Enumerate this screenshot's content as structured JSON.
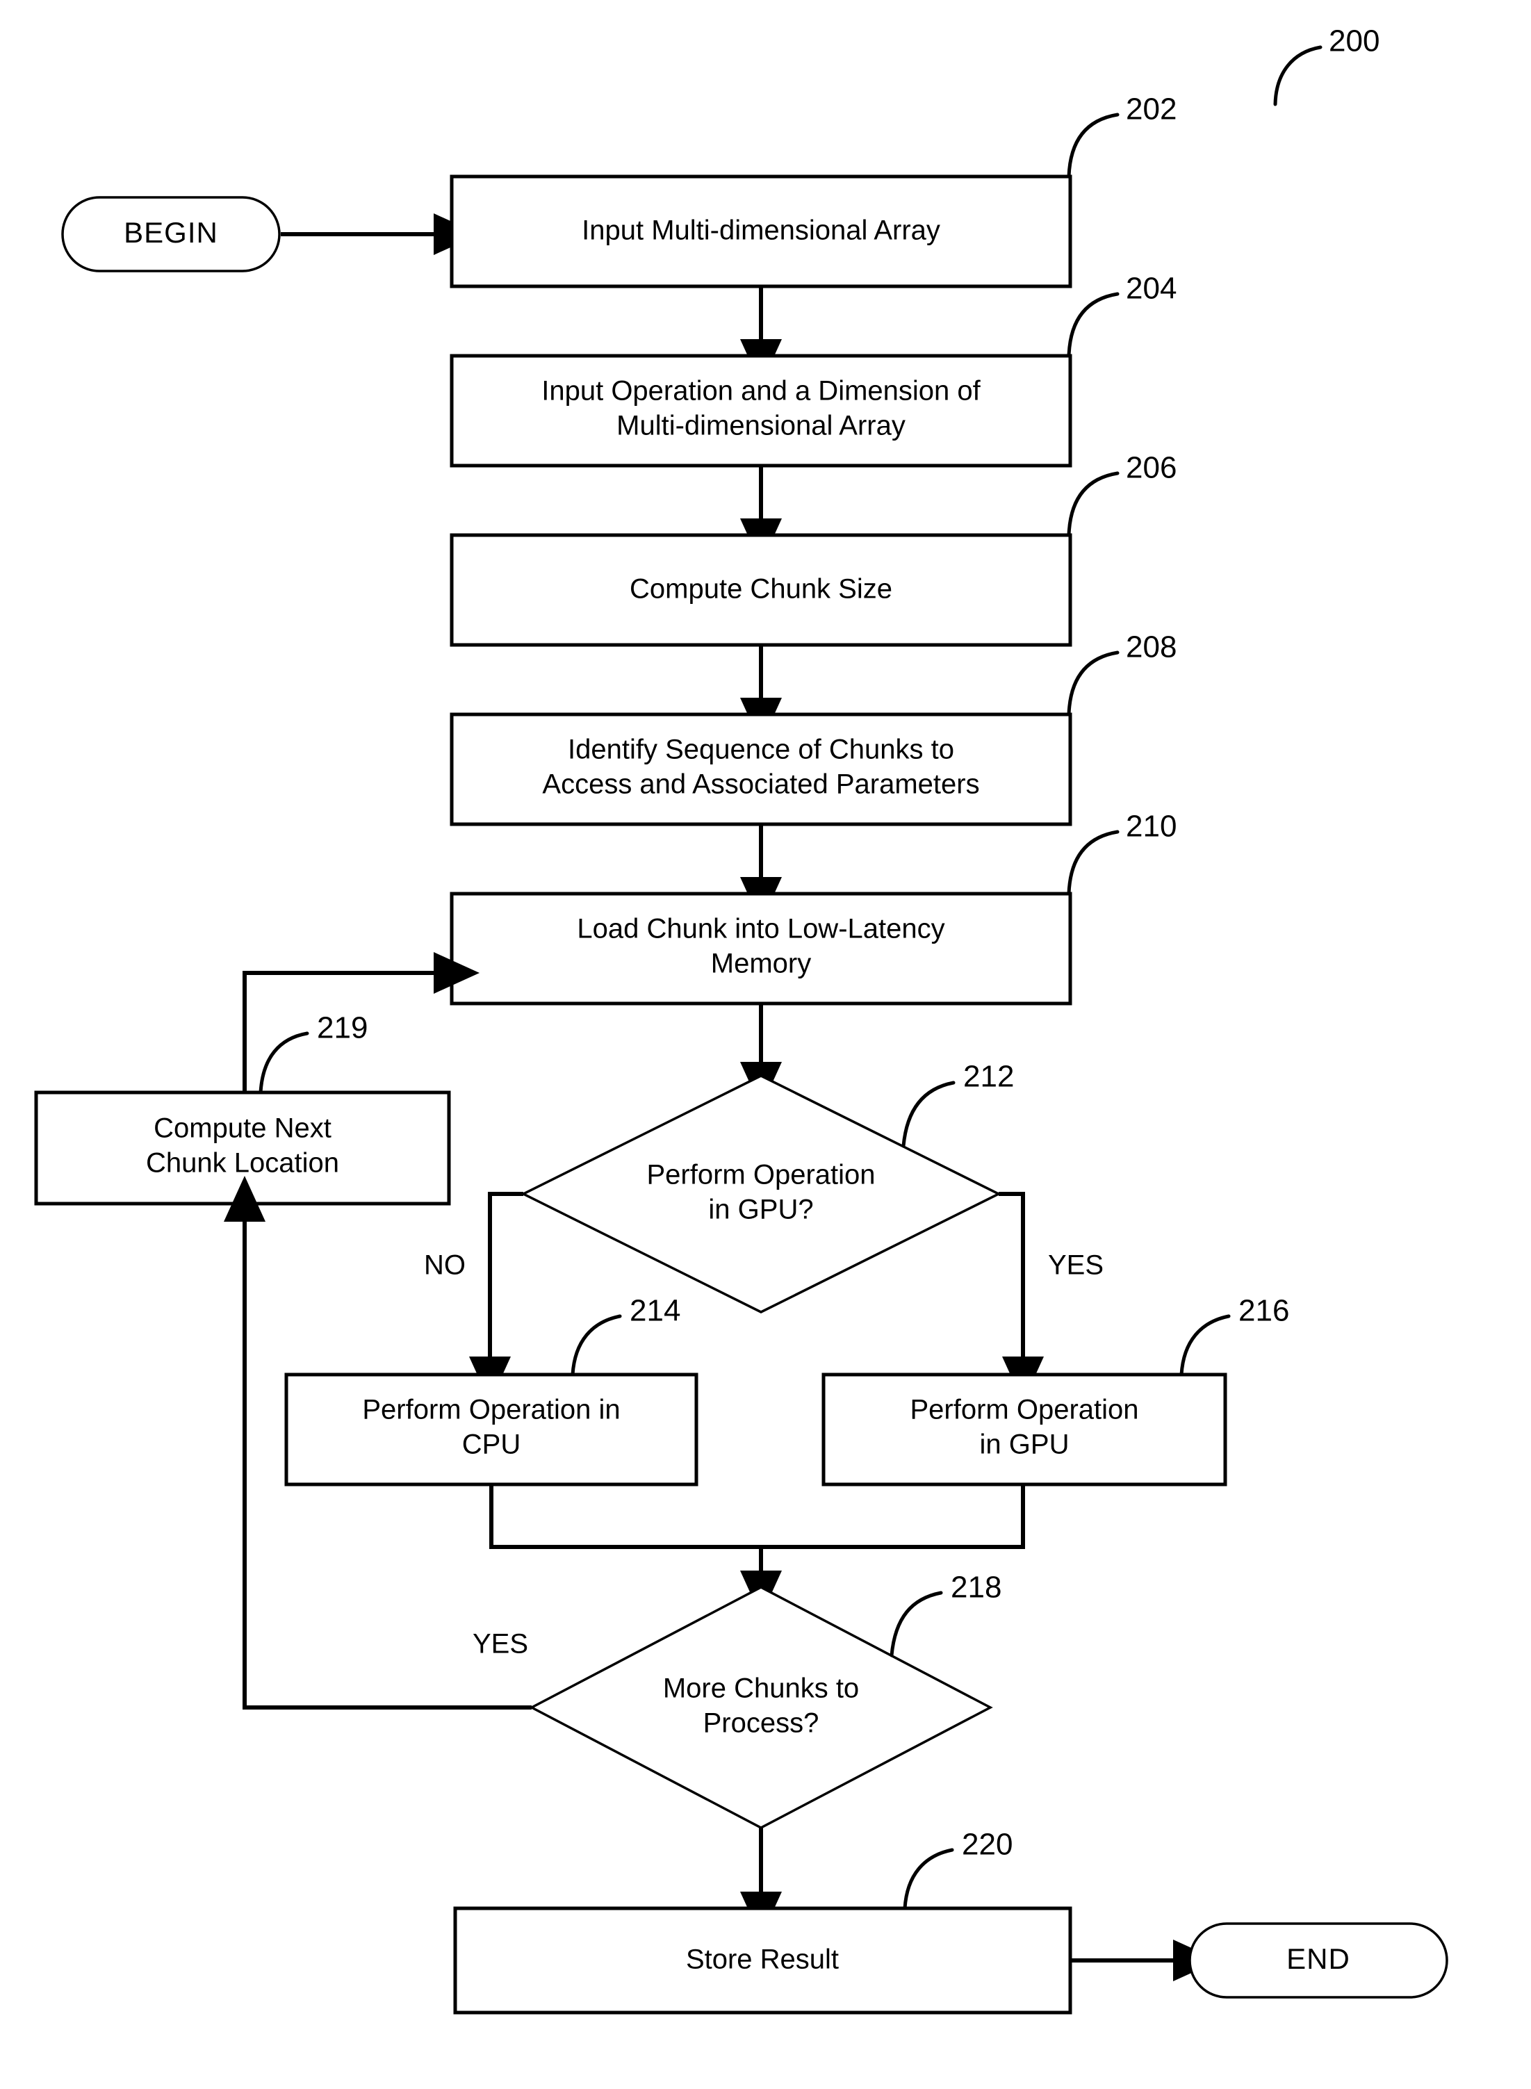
{
  "figure": {
    "ref": "200",
    "type": "patent-flowchart"
  },
  "terminals": {
    "begin": "BEGIN",
    "end": "END"
  },
  "nodes": [
    {
      "ref": "202",
      "kind": "process",
      "line1": "Input Multi-dimensional Array",
      "line2": ""
    },
    {
      "ref": "204",
      "kind": "process",
      "line1": "Input Operation and a Dimension of",
      "line2": "Multi-dimensional Array"
    },
    {
      "ref": "206",
      "kind": "process",
      "line1": "Compute Chunk Size",
      "line2": ""
    },
    {
      "ref": "208",
      "kind": "process",
      "line1": "Identify Sequence of Chunks to",
      "line2": "Access and Associated Parameters"
    },
    {
      "ref": "210",
      "kind": "process",
      "line1": "Load Chunk into Low-Latency",
      "line2": "Memory"
    },
    {
      "ref": "212",
      "kind": "decision",
      "line1": "Perform Operation",
      "line2": "in GPU?"
    },
    {
      "ref": "214",
      "kind": "process",
      "line1": "Perform Operation in",
      "line2": "CPU"
    },
    {
      "ref": "216",
      "kind": "process",
      "line1": "Perform Operation",
      "line2": "in GPU"
    },
    {
      "ref": "218",
      "kind": "decision",
      "line1": "More Chunks  to",
      "line2": "Process?"
    },
    {
      "ref": "219",
      "kind": "process",
      "line1": "Compute Next",
      "line2": "Chunk Location"
    },
    {
      "ref": "220",
      "kind": "process",
      "line1": "Store Result",
      "line2": ""
    }
  ],
  "branch_labels": {
    "gpu_no": "NO",
    "gpu_yes": "YES",
    "more_chunks_yes": "YES"
  },
  "colors": {
    "stroke": "#000000",
    "fill": "#ffffff",
    "background": "#ffffff"
  }
}
